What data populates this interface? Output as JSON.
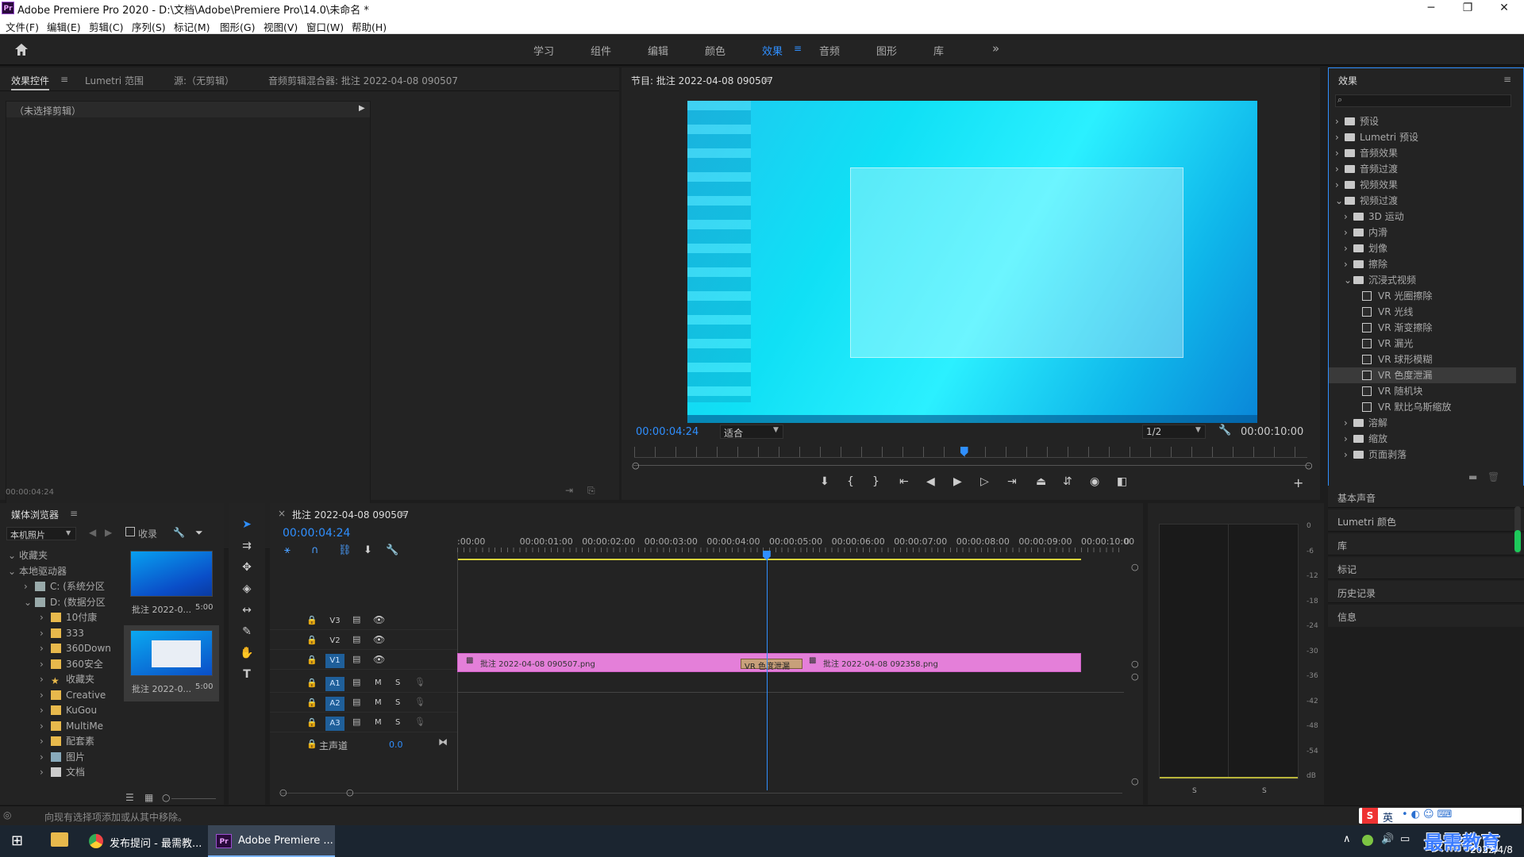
{
  "window": {
    "title": "Adobe Premiere Pro 2020 - D:\\文档\\Adobe\\Premiere Pro\\14.0\\未命名 *",
    "app_icon": "Pr",
    "controls": [
      "─",
      "❐",
      "✕"
    ]
  },
  "menu": [
    "文件(F)",
    "编辑(E)",
    "剪辑(C)",
    "序列(S)",
    "标记(M)",
    "图形(G)",
    "视图(V)",
    "窗口(W)",
    "帮助(H)"
  ],
  "workspaces": {
    "items": [
      "学习",
      "组件",
      "编辑",
      "颜色",
      "效果",
      "音频",
      "图形",
      "库"
    ],
    "active": "效果",
    "more": "»"
  },
  "source_panel": {
    "tabs": [
      "效果控件",
      "Lumetri 范围",
      "源:（无剪辑）",
      "音频剪辑混合器: 批注 2022-04-08 090507"
    ],
    "no_clip": "（未选择剪辑）",
    "timecode": "00:00:04:24"
  },
  "program": {
    "title": "节目: 批注 2022-04-08 090507",
    "timecode": "00:00:04:24",
    "fit": "适合",
    "quality": "1/2",
    "duration": "00:00:10:00",
    "playhead_fraction": 0.49
  },
  "effects_panel": {
    "title": "效果",
    "tree": [
      {
        "label": "预设",
        "level": 0,
        "kind": "folder",
        "state": "collapsed"
      },
      {
        "label": "Lumetri 预设",
        "level": 0,
        "kind": "folder",
        "state": "collapsed"
      },
      {
        "label": "音频效果",
        "level": 0,
        "kind": "folder",
        "state": "collapsed"
      },
      {
        "label": "音频过渡",
        "level": 0,
        "kind": "folder",
        "state": "collapsed"
      },
      {
        "label": "视频效果",
        "level": 0,
        "kind": "folder",
        "state": "collapsed"
      },
      {
        "label": "视频过渡",
        "level": 0,
        "kind": "folder",
        "state": "expanded"
      },
      {
        "label": "3D 运动",
        "level": 1,
        "kind": "folder",
        "state": "collapsed"
      },
      {
        "label": "内滑",
        "level": 1,
        "kind": "folder",
        "state": "collapsed"
      },
      {
        "label": "划像",
        "level": 1,
        "kind": "folder",
        "state": "collapsed"
      },
      {
        "label": "擦除",
        "level": 1,
        "kind": "folder",
        "state": "collapsed"
      },
      {
        "label": "沉浸式视频",
        "level": 1,
        "kind": "folder",
        "state": "expanded"
      },
      {
        "label": "VR 光圈擦除",
        "level": 2,
        "kind": "effect"
      },
      {
        "label": "VR 光线",
        "level": 2,
        "kind": "effect"
      },
      {
        "label": "VR 渐变擦除",
        "level": 2,
        "kind": "effect"
      },
      {
        "label": "VR 漏光",
        "level": 2,
        "kind": "effect"
      },
      {
        "label": "VR 球形模糊",
        "level": 2,
        "kind": "effect"
      },
      {
        "label": "VR 色度泄漏",
        "level": 2,
        "kind": "effect",
        "selected": true
      },
      {
        "label": "VR 随机块",
        "level": 2,
        "kind": "effect"
      },
      {
        "label": "VR 默比乌斯缩放",
        "level": 2,
        "kind": "effect"
      },
      {
        "label": "溶解",
        "level": 1,
        "kind": "folder",
        "state": "collapsed"
      },
      {
        "label": "缩放",
        "level": 1,
        "kind": "folder",
        "state": "collapsed"
      },
      {
        "label": "页面剥落",
        "level": 1,
        "kind": "folder",
        "state": "collapsed"
      }
    ]
  },
  "side_panels": [
    "基本声音",
    "Lumetri 颜色",
    "库",
    "标记",
    "历史记录",
    "信息"
  ],
  "media_browser": {
    "title": "媒体浏览器",
    "location": "本机照片",
    "ingest": "收录",
    "tree": [
      {
        "label": "收藏夹",
        "level": 0
      },
      {
        "label": "本地驱动器",
        "level": 0
      },
      {
        "label": "C: (系统分区",
        "level": 1,
        "kind": "drive"
      },
      {
        "label": "D: (数据分区",
        "level": 1,
        "kind": "drive"
      },
      {
        "label": "10付康",
        "level": 2,
        "kind": "folder"
      },
      {
        "label": "333",
        "level": 2,
        "kind": "folder"
      },
      {
        "label": "360Down",
        "level": 2,
        "kind": "folder"
      },
      {
        "label": "360安全",
        "level": 2,
        "kind": "folder"
      },
      {
        "label": "收藏夹",
        "level": 2,
        "kind": "star"
      },
      {
        "label": "Creative",
        "level": 2,
        "kind": "folder"
      },
      {
        "label": "KuGou",
        "level": 2,
        "kind": "folder"
      },
      {
        "label": "MultiMe",
        "level": 2,
        "kind": "folder"
      },
      {
        "label": "配套素",
        "level": 2,
        "kind": "folder"
      },
      {
        "label": "图片",
        "level": 2,
        "kind": "picture"
      },
      {
        "label": "文档",
        "level": 2,
        "kind": "doc"
      }
    ],
    "thumbnails": [
      {
        "name": "批注 2022-0...",
        "duration": "5:00"
      },
      {
        "name": "批注 2022-0...",
        "duration": "5:00"
      }
    ]
  },
  "timeline": {
    "tab": "批注 2022-04-08 090507",
    "timecode": "00:00:04:24",
    "ruler": [
      ":00:00",
      "00:00:01:00",
      "00:00:02:00",
      "00:00:03:00",
      "00:00:04:00",
      "00:00:05:00",
      "00:00:06:00",
      "00:00:07:00",
      "00:00:08:00",
      "00:00:09:00",
      "00:00:10:00",
      "0"
    ],
    "video_tracks": [
      "V3",
      "V2",
      "V1"
    ],
    "audio_tracks": [
      "A1",
      "A2",
      "A3"
    ],
    "master": "主声道",
    "master_value": "0.0",
    "clips": [
      {
        "label": "批注 2022-04-08 090507.png"
      },
      {
        "label": "批注 2022-04-08 092358.png"
      }
    ],
    "transition": "VR 色度泄漏",
    "mute": "M",
    "solo": "S"
  },
  "meter": {
    "labels": [
      "0",
      "-6",
      "-12",
      "-18",
      "-24",
      "-30",
      "-36",
      "-42",
      "-48",
      "-54",
      "dB"
    ],
    "solo": [
      "S",
      "S"
    ]
  },
  "statusbar": "向现有选择项添加或从其中移除。",
  "taskbar": {
    "apps": [
      {
        "label": "发布提问 - 最需教..."
      },
      {
        "label": "Adobe Premiere ..."
      }
    ],
    "date": "2022/4/8",
    "ime": "英",
    "watermark": "最需教育"
  },
  "colors": {
    "accent": "#2f8fff",
    "clip": "#e47fd9",
    "transition": "#c8a07a",
    "playhead": "#2f8fff",
    "work_area": "#d8d23a"
  }
}
